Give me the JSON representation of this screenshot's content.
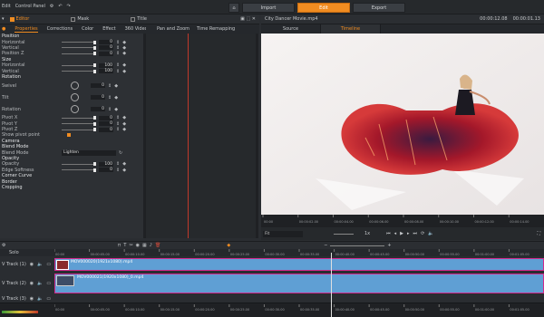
{
  "app": {
    "menu": [
      "Edit",
      "Control Panel"
    ],
    "modes": [
      "Import",
      "Edit",
      "Export"
    ],
    "active_mode": "Edit"
  },
  "panel": {
    "tabs": [
      "Editor",
      "Mask",
      "Title"
    ]
  },
  "subtabs": [
    "Properties",
    "Corrections",
    "Color",
    "Effect",
    "360 Video",
    "Pan and Zoom",
    "Time Remapping"
  ],
  "props": {
    "position": "Position",
    "horizontal": "Horizontal",
    "vertical": "Vertical",
    "position_z": "Position Z",
    "pos_h": "0",
    "pos_v": "0",
    "pos_z": "0",
    "size": "Size",
    "size_h": "100",
    "size_v": "100",
    "rotation": "Rotation",
    "swivel": "Swivel",
    "tilt": "Tilt",
    "rotation2": "Rotation",
    "rot_swivel": "0",
    "rot_tilt": "0",
    "rot_rot": "0",
    "pivot_x": "Pivot X",
    "pivot_y": "Pivot Y",
    "pivot_z": "Pivot Z",
    "pv_x": "0",
    "pv_y": "0",
    "pv_z": "0",
    "show_pivot": "Show pivot point",
    "camera": "Camera",
    "blend_mode_section": "Blend Mode",
    "blend_mode": "Blend Mode",
    "blend_value": "Lighten",
    "opacity_section": "Opacity",
    "opacity": "Opacity",
    "opacity_value": "100",
    "edge_softness": "Edge Softness",
    "edge_value": "0",
    "corner_curve": "Corner Curve",
    "border": "Border",
    "cropping": "Cropping"
  },
  "preview": {
    "title": "City Dancer Movie.mp4",
    "time_in": "00:00:12.08",
    "time_dur": "00:00:01.13",
    "tabs": [
      "Source",
      "Timeline"
    ],
    "active_tab": "Timeline",
    "ruler_ticks": [
      "00:00",
      "00:00:02.00",
      "00:00:04.00",
      "00:00:06.00",
      "00:00:08.00",
      "00:00:10.00",
      "00:00:12.00",
      "00:00:14.00"
    ],
    "fit": "Fit",
    "speed": "1x"
  },
  "timeline": {
    "solo": "Solo",
    "tracks": [
      "V Track (1)",
      "V Track (2)",
      "V Track (3)"
    ],
    "clip1": "MOV000020(1921x1080).mp4",
    "clip2": "MOV000021(1920x1080)_0.mp4",
    "ruler": [
      "00:00",
      "00:00:05.00",
      "00:00:10.00",
      "00:00:15.00",
      "00:00:20.00",
      "00:00:25.00",
      "00:00:30.00",
      "00:00:35.00",
      "00:00:40.00",
      "00:00:45.00",
      "00:00:50.00",
      "00:00:55.00",
      "00:01:00.00",
      "00:01:05.00"
    ]
  },
  "colors": {
    "accent": "#f08c21",
    "clip": "#5f9fd4",
    "clip_border": "#d22a8d",
    "playhead": "#c0392b"
  }
}
